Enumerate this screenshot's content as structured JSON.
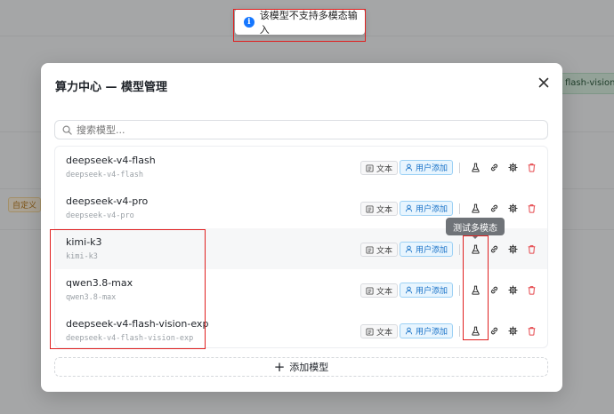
{
  "toast": {
    "message": "该模型不支持多模态输入"
  },
  "background": {
    "custom_tag": "自定义",
    "right_label": "flash-vision-exp"
  },
  "modal": {
    "title": "算力中心 — 模型管理",
    "search_placeholder": "搜索模型...",
    "add_button": "添加模型",
    "tooltip": "测试多模态",
    "models": [
      {
        "name": "deepseek-v4-flash",
        "id": "deepseek-v4-flash",
        "type_tag": "文本",
        "source_tag": "用户添加"
      },
      {
        "name": "deepseek-v4-pro",
        "id": "deepseek-v4-pro",
        "type_tag": "文本",
        "source_tag": "用户添加"
      },
      {
        "name": "kimi-k3",
        "id": "kimi-k3",
        "type_tag": "文本",
        "source_tag": "用户添加"
      },
      {
        "name": "qwen3.8-max",
        "id": "qwen3.8-max",
        "type_tag": "文本",
        "source_tag": "用户添加"
      },
      {
        "name": "deepseek-v4-flash-vision-exp",
        "id": "deepseek-v4-flash-vision-exp",
        "type_tag": "文本",
        "source_tag": "用户添加"
      }
    ]
  },
  "icons": {
    "info": "info-icon",
    "close": "close-icon",
    "search": "search-icon",
    "text": "text-icon",
    "user": "user-icon",
    "flask": "flask-icon",
    "link": "link-icon",
    "gear": "gear-icon",
    "trash": "trash-icon",
    "plus": "plus-icon"
  },
  "colors": {
    "accent": "#1677ff",
    "danger": "#e5484d",
    "highlight": "#e02020"
  }
}
